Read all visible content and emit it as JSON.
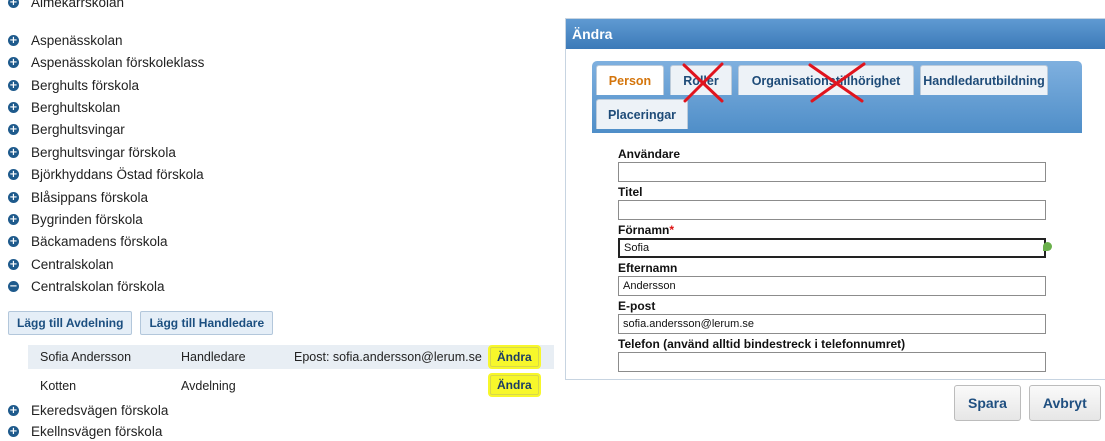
{
  "tree": {
    "partial_top": "Almekärrskolan",
    "items": [
      {
        "label": "Aspenässkolan",
        "expanded": false
      },
      {
        "label": "Aspenässkolan förskoleklass",
        "expanded": false
      },
      {
        "label": "Berghults förskola",
        "expanded": false
      },
      {
        "label": "Berghultskolan",
        "expanded": false
      },
      {
        "label": "Berghultsvingar",
        "expanded": false
      },
      {
        "label": "Berghultsvingar förskola",
        "expanded": false
      },
      {
        "label": "Björkhyddans Östad förskola",
        "expanded": false
      },
      {
        "label": "Blåsippans förskola",
        "expanded": false
      },
      {
        "label": "Bygrinden förskola",
        "expanded": false
      },
      {
        "label": "Bäckamadens förskola",
        "expanded": false
      },
      {
        "label": "Centralskolan",
        "expanded": false
      },
      {
        "label": "Centralskolan förskola",
        "expanded": true
      }
    ],
    "after_items": [
      {
        "label": "Ekeredsvägen förskola"
      },
      {
        "label": "Ekellnsvägen förskola"
      }
    ],
    "expand_glyph": "+",
    "collapse_glyph": "−"
  },
  "buttons": {
    "add_department": "Lägg till Avdelning",
    "add_supervisor": "Lägg till Handledare"
  },
  "members": [
    {
      "name": "Sofia Andersson",
      "role": "Handledare",
      "email": "Epost: sofia.andersson@lerum.se",
      "action": "Ändra"
    },
    {
      "name": "Kotten",
      "role": "Avdelning",
      "email": "",
      "action": "Ändra"
    }
  ],
  "dialog": {
    "title": "Ändra",
    "tabs": [
      {
        "label": "Person",
        "active": true,
        "crossed": false
      },
      {
        "label": "Roller",
        "active": false,
        "crossed": true
      },
      {
        "label": "Organisationstillhörighet",
        "active": false,
        "crossed": true
      },
      {
        "label": "Handledarutbildning",
        "active": false,
        "crossed": false
      },
      {
        "label": "Placeringar",
        "active": false,
        "crossed": false
      }
    ],
    "fields": [
      {
        "label": "Användare",
        "value": "",
        "required": false
      },
      {
        "label": "Titel",
        "value": "",
        "required": false
      },
      {
        "label": "Förnamn",
        "value": "Sofia",
        "required": true
      },
      {
        "label": "Efternamn",
        "value": "Andersson",
        "required": false
      },
      {
        "label": "E-post",
        "value": "sofia.andersson@lerum.se",
        "required": false
      },
      {
        "label": "Telefon (använd alltid bindestreck i telefonnumret)",
        "value": "",
        "required": false
      }
    ],
    "required_marker": "*",
    "save": "Spara",
    "cancel": "Avbryt"
  },
  "colors": {
    "tree_icon": "#1e5a8c",
    "title_bar": "#4a88c4",
    "active_tab_text": "#d4750c",
    "highlight": "#f7f72b",
    "annotation_cross": "#e0141e"
  },
  "icons": [
    "expand-icon",
    "collapse-icon",
    "leaf-icon"
  ]
}
